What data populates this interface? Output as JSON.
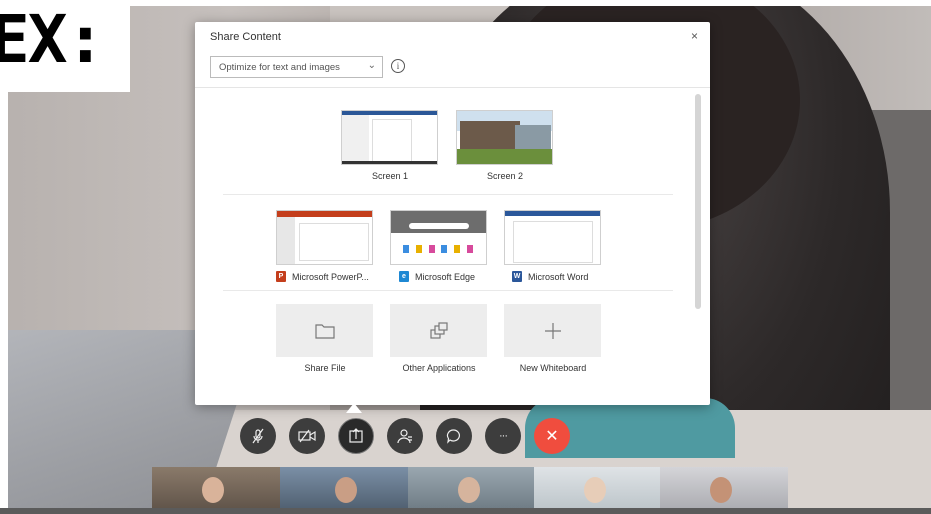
{
  "label": {
    "text": "EX:"
  },
  "dialog": {
    "title": "Share Content",
    "close_symbol": "×",
    "optimize_select": {
      "value": "Optimize for text and images",
      "chevron": "chevron-down-icon"
    },
    "info_icon": "info-icon",
    "screens": [
      {
        "label": "Screen 1"
      },
      {
        "label": "Screen 2"
      }
    ],
    "applications": [
      {
        "label": "Microsoft PowerP...",
        "icon": "powerpoint-icon",
        "icon_color": "#c43e1c",
        "glyph": "P"
      },
      {
        "label": "Microsoft Edge",
        "icon": "edge-icon",
        "icon_color": "#1e88d3",
        "glyph": "e"
      },
      {
        "label": "Microsoft Word",
        "icon": "word-icon",
        "icon_color": "#2b579a",
        "glyph": "W"
      }
    ],
    "actions": [
      {
        "label": "Share File",
        "icon": "folder-icon"
      },
      {
        "label": "Other Applications",
        "icon": "windows-stack-icon"
      },
      {
        "label": "New Whiteboard",
        "icon": "plus-icon"
      }
    ]
  },
  "controls": [
    {
      "name": "mute-button",
      "icon": "microphone-off-icon",
      "glyph": "✗"
    },
    {
      "name": "video-button",
      "icon": "camera-off-icon",
      "glyph": "⊘"
    },
    {
      "name": "share-button",
      "icon": "share-icon",
      "glyph": "⇧",
      "active": true
    },
    {
      "name": "participants-button",
      "icon": "participants-icon",
      "glyph": "♙"
    },
    {
      "name": "chat-button",
      "icon": "chat-icon",
      "glyph": "○"
    },
    {
      "name": "more-button",
      "icon": "more-icon",
      "glyph": "···"
    },
    {
      "name": "end-call-button",
      "icon": "close-icon",
      "glyph": "✕",
      "end": true
    }
  ],
  "colors": {
    "end_call": "#f04d3e",
    "accent": "#2b579a"
  }
}
